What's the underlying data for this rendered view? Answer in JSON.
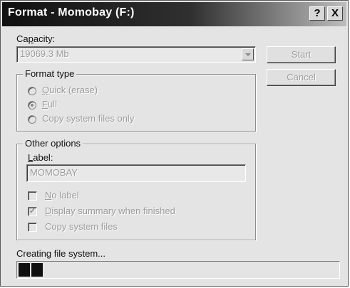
{
  "window": {
    "title": "Format - Momobay (F:)",
    "help_glyph": "?",
    "close_glyph": "X"
  },
  "capacity": {
    "label_prefix": "Ca",
    "label_underlined": "p",
    "label_suffix": "acity:",
    "value": "19069.3 Mb"
  },
  "buttons": {
    "start": "Start",
    "cancel": "Cancel"
  },
  "format_type": {
    "legend": "Format type",
    "options": [
      {
        "accel": "Q",
        "rest": "uick (erase)",
        "checked": false
      },
      {
        "accel": "F",
        "rest": "ull",
        "checked": true
      },
      {
        "accel": "",
        "rest": "Copy system files only",
        "checked": false
      }
    ]
  },
  "other_options": {
    "legend": "Other options",
    "label_prefix": "",
    "label_underlined": "L",
    "label_suffix": "abel:",
    "label_value": "MOMOBAY",
    "checkboxes": [
      {
        "accel": "N",
        "rest": "o label",
        "checked": false
      },
      {
        "accel": "D",
        "rest": "isplay summary when finished",
        "checked": true
      },
      {
        "accel": "",
        "rest": "Copy system files",
        "checked": false
      }
    ]
  },
  "status": {
    "text": "Creating file system..."
  },
  "progress": {
    "filled_blocks": 2,
    "color": "#101010"
  }
}
